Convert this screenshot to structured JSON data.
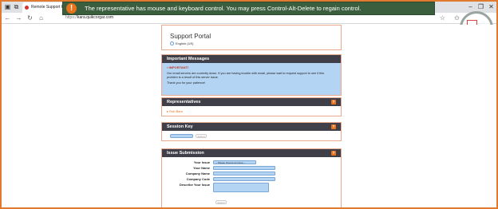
{
  "browser": {
    "tab_title": "Remote Support Portal",
    "tab_close": "×",
    "new_tab": "+",
    "url_prefix": "https://",
    "url_host": "kara.quikcorgar.com",
    "nav_back": "←",
    "nav_forward": "→",
    "nav_reload": "↻",
    "nav_home": "⌂",
    "window_minimize": "–",
    "window_maximize": "❐",
    "window_close": "✕"
  },
  "banner": {
    "icon": "!",
    "text": "The representative has mouse and keyboard control. You may press Control-Alt-Delete to regain control."
  },
  "portal": {
    "title": "Support Portal",
    "language": "English (US)"
  },
  "messages": {
    "heading": "Important Messages",
    "important_label": "IMPORTANT!",
    "line1": "Our email servers are currently down. If you are having trouble with email, please wait to request support to see if this",
    "line2": "problem is a result of this server issue.",
    "line3": "Thank you for your patience!"
  },
  "representatives": {
    "heading": "Representatives",
    "help": "?",
    "items": [
      {
        "name": "Rob Barn"
      }
    ]
  },
  "session_key": {
    "heading": "Session Key",
    "help": "?",
    "button_label": "Submit"
  },
  "issue": {
    "heading": "Issue Submission",
    "help": "?",
    "labels": {
      "your_issue": "Your Issue",
      "your_name": "Your Name",
      "company_name": "Company Name",
      "company_code": "Company Code",
      "describe": "Describe Your Issue"
    },
    "select_placeholder": "-- Please choose an issue --",
    "submit_label": "Submit"
  },
  "colors": {
    "banner_bg": "#3b5e3e",
    "accent": "#e8731a",
    "panel_header": "#3f3f49",
    "field_bg": "#b3d4f2"
  }
}
